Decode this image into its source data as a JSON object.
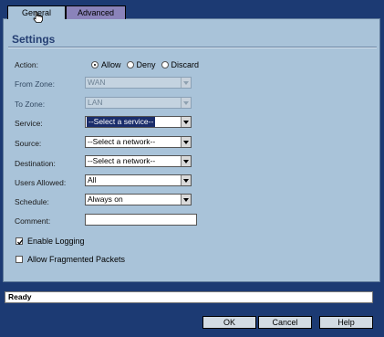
{
  "tabs": [
    {
      "label": "General",
      "active": true
    },
    {
      "label": "Advanced",
      "active": false
    }
  ],
  "settings": {
    "title": "Settings",
    "action": {
      "label": "Action:",
      "options": [
        "Allow",
        "Deny",
        "Discard"
      ],
      "selected": "Allow"
    },
    "from_zone": {
      "label": "From Zone:",
      "value": "WAN",
      "disabled": true
    },
    "to_zone": {
      "label": "To Zone:",
      "value": "LAN",
      "disabled": true
    },
    "service": {
      "label": "Service:",
      "value": "--Select a service--"
    },
    "source": {
      "label": "Source:",
      "value": "--Select a network--"
    },
    "destination": {
      "label": "Destination:",
      "value": "--Select a network--"
    },
    "users_allowed": {
      "label": "Users Allowed:",
      "value": "All"
    },
    "schedule": {
      "label": "Schedule:",
      "value": "Always on"
    },
    "comment": {
      "label": "Comment:",
      "value": ""
    },
    "enable_logging": {
      "label": "Enable Logging",
      "checked": true
    },
    "allow_fragmented": {
      "label": "Allow Fragmented Packets",
      "checked": false
    }
  },
  "status": {
    "text": "Ready"
  },
  "buttons": {
    "ok": "OK",
    "cancel": "Cancel",
    "help": "Help"
  },
  "colors": {
    "background": "#1c3a73",
    "panel": "#a9c3d9",
    "active_tab": "#a9c3d9",
    "inactive_tab": "#8a83ba",
    "title": "#253f73",
    "highlight": "#1a2d6b"
  },
  "icons": {
    "cursor": "hand-pointer-icon",
    "dropdown": "chevron-down-icon",
    "check": "checkmark-icon"
  }
}
